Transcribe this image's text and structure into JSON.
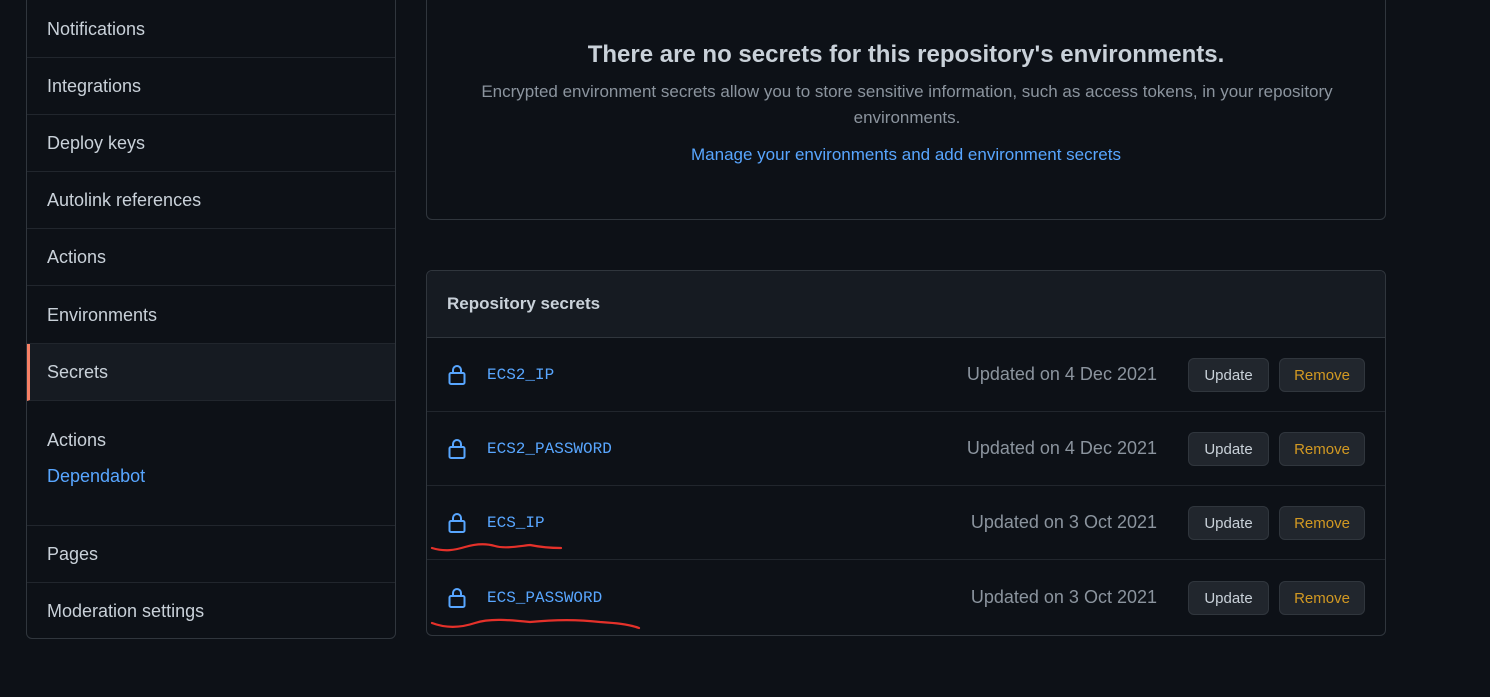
{
  "sidebar": {
    "items": [
      {
        "label": "Notifications"
      },
      {
        "label": "Integrations"
      },
      {
        "label": "Deploy keys"
      },
      {
        "label": "Autolink references"
      },
      {
        "label": "Actions"
      },
      {
        "label": "Environments"
      },
      {
        "label": "Secrets",
        "selected": true
      }
    ],
    "secrets_sub": {
      "actions": "Actions",
      "dependabot": "Dependabot"
    },
    "bottom_items": [
      {
        "label": "Pages"
      },
      {
        "label": "Moderation settings"
      }
    ]
  },
  "environment_secrets": {
    "title": "There are no secrets for this repository's environments.",
    "description": "Encrypted environment secrets allow you to store sensitive information, such as access tokens, in your repository environments.",
    "link": "Manage your environments and add environment secrets"
  },
  "repository_secrets": {
    "header": "Repository secrets",
    "rows": [
      {
        "name": "ECS2_IP",
        "updated": "Updated on 4 Dec 2021",
        "update_label": "Update",
        "remove_label": "Remove"
      },
      {
        "name": "ECS2_PASSWORD",
        "updated": "Updated on 4 Dec 2021",
        "update_label": "Update",
        "remove_label": "Remove"
      },
      {
        "name": "ECS_IP",
        "updated": "Updated on 3 Oct 2021",
        "update_label": "Update",
        "remove_label": "Remove"
      },
      {
        "name": "ECS_PASSWORD",
        "updated": "Updated on 3 Oct 2021",
        "update_label": "Update",
        "remove_label": "Remove"
      }
    ]
  },
  "colors": {
    "background": "#0d1117",
    "link": "#58a6ff",
    "selected_accent": "#f78166",
    "remove_text": "#d29922",
    "annotation": "#e5312a"
  },
  "icons": {
    "secret_row": "lock-icon"
  }
}
